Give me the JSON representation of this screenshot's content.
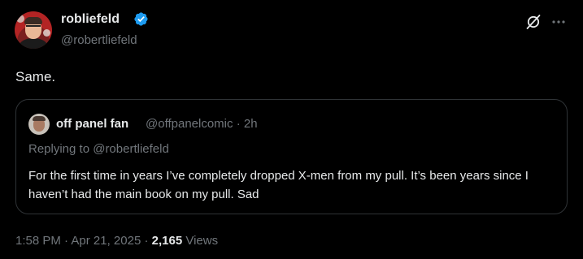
{
  "author": {
    "display_name": "robliefeld",
    "handle": "@robertliefeld"
  },
  "tweet": {
    "text": "Same."
  },
  "quote": {
    "display_name": "off panel fan",
    "handle": "@offpanelcomic",
    "separator": "·",
    "time": "2h",
    "replying_to": "Replying to @robertliefeld",
    "text": "For the first time in years I’ve completely dropped X-men from my pull. It’s been years since I haven’t had the main book on my pull. Sad"
  },
  "footer": {
    "time": "1:58 PM",
    "dot1": "·",
    "date": "Apr 21, 2025",
    "dot2": "·",
    "views_count": "2,165",
    "views_label": "Views"
  },
  "icons": {
    "verified": "verified-badge-icon",
    "grok": "grok-icon",
    "more": "more-options-icon"
  },
  "colors": {
    "background": "#000000",
    "text_primary": "#e7e9ea",
    "text_secondary": "#71767b",
    "border": "#2f3336",
    "verified_blue": "#1d9bf0"
  }
}
